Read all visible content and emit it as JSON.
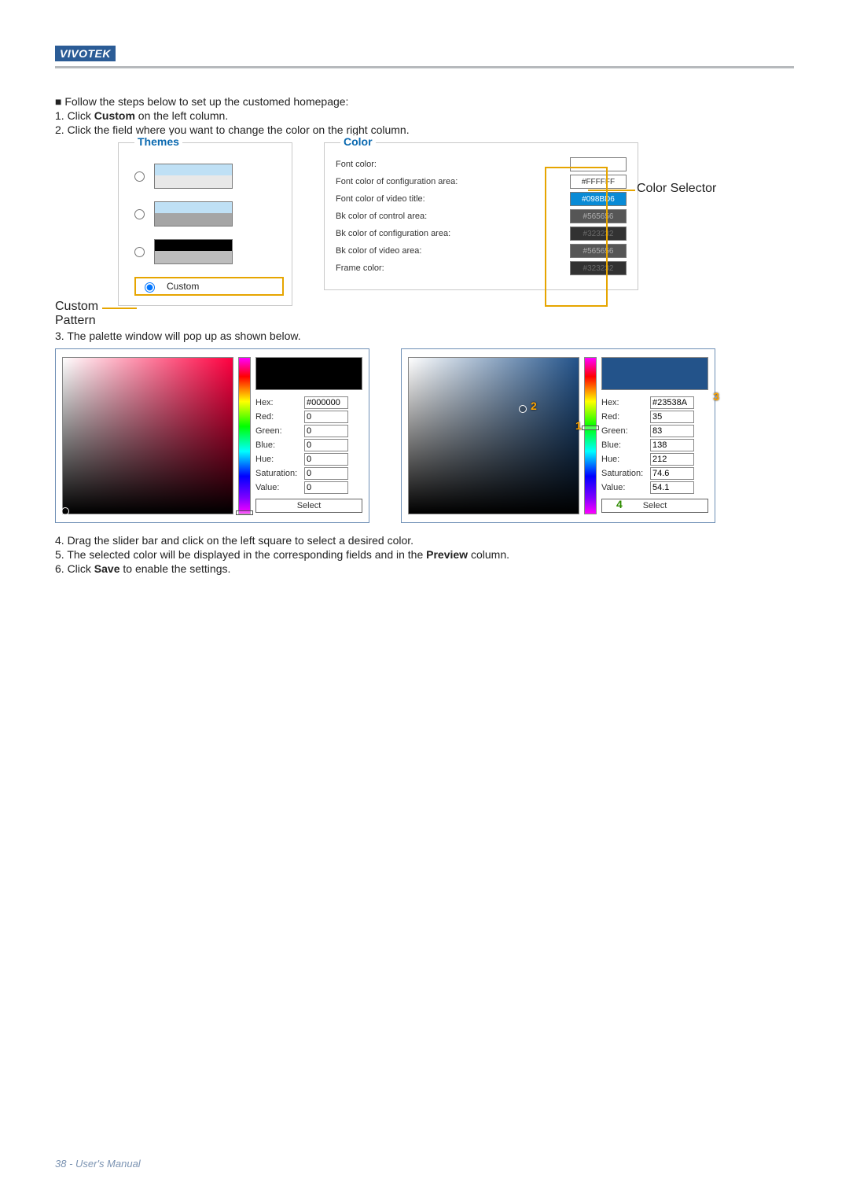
{
  "brand": "VIVOTEK",
  "intro": "■ Follow the steps below to set up the customed homepage:",
  "step1_a": "1. Click ",
  "step1_b": "Custom",
  "step1_c": " on the left column.",
  "step2": "2. Click the field where you want to change the color on the right column.",
  "custom_pattern_label_1": "Custom",
  "custom_pattern_label_2": "Pattern",
  "themes_legend": "Themes",
  "custom_radio_label": "Custom",
  "color_legend": "Color",
  "color_rows": {
    "r0": {
      "label": "Font color:",
      "swatch": ""
    },
    "r1": {
      "label": "Font color of configuration area:",
      "swatch": "#FFFFFF"
    },
    "r2": {
      "label": "Font color of video title:",
      "swatch": "#098BD6"
    },
    "r3": {
      "label": "Bk color of control area:",
      "swatch": "#565656"
    },
    "r4": {
      "label": "Bk color of configuration area:",
      "swatch": "#323232"
    },
    "r5": {
      "label": "Bk color of video area:",
      "swatch": "#565656"
    },
    "r6": {
      "label": "Frame color:",
      "swatch": "#323232"
    }
  },
  "color_selector_callout": "Color Selector",
  "step3": "3. The palette window will pop up as shown below.",
  "palette_labels": {
    "hex": "Hex:",
    "red": "Red:",
    "green": "Green:",
    "blue": "Blue:",
    "hue": "Hue:",
    "saturation": "Saturation:",
    "value": "Value:",
    "select": "Select"
  },
  "palette1": {
    "hex": "#000000",
    "red": "0",
    "green": "0",
    "blue": "0",
    "hue": "0",
    "saturation": "0",
    "value": "0"
  },
  "palette2": {
    "hex": "#23538A",
    "red": "35",
    "green": "83",
    "blue": "138",
    "hue": "212",
    "saturation": "74.6",
    "value": "54.1"
  },
  "annot": {
    "n1": "1",
    "n2": "2",
    "n3": "3",
    "n4": "4"
  },
  "step4": "4. Drag the slider bar and click on the left square to select a desired color.",
  "step5_a": "5. The selected color will be displayed in the corresponding fields and in the ",
  "step5_b": "Preview",
  "step5_c": " column.",
  "step6_a": "6. Click ",
  "step6_b": "Save",
  "step6_c": " to enable the settings.",
  "footer": "38 - User's Manual"
}
